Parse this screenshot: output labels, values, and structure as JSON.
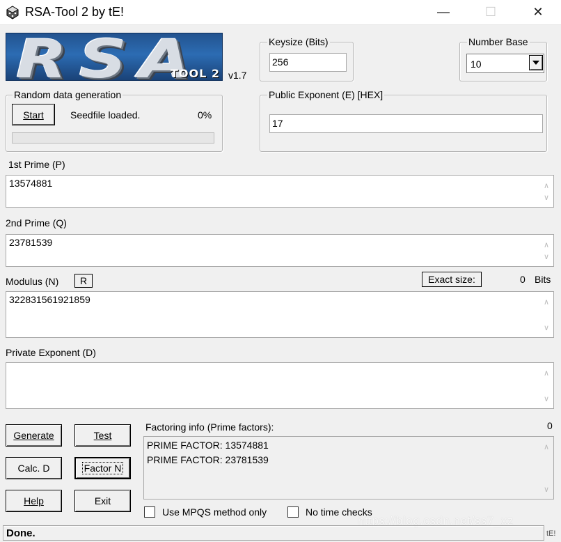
{
  "window": {
    "title": "RSA-Tool 2 by tE!",
    "minimize_glyph": "—",
    "maximize_glyph": "☐",
    "close_glyph": "✕"
  },
  "logo": {
    "main_text": "RSA",
    "sub_text": "TOOL 2",
    "version": "v1.7"
  },
  "keysize": {
    "legend": "Keysize (Bits)",
    "value": "256"
  },
  "number_base": {
    "legend": "Number Base",
    "selected": "10"
  },
  "random_data": {
    "legend": "Random data generation",
    "start_label": "Start",
    "status": "Seedfile loaded.",
    "percent": "0%",
    "progress": 0
  },
  "public_exponent": {
    "legend": "Public Exponent (E) [HEX]",
    "value": "17"
  },
  "prime_p": {
    "label": "1st Prime (P)",
    "value": "13574881"
  },
  "prime_q": {
    "label": "2nd Prime (Q)",
    "value": "23781539"
  },
  "modulus": {
    "label": "Modulus (N)",
    "r_button": "R",
    "exact_size_button": "Exact size:",
    "size_value": "0",
    "bits_label": "Bits",
    "value": "322831561921859"
  },
  "private_exponent": {
    "label": "Private Exponent (D)",
    "value": ""
  },
  "buttons": {
    "generate": "Generate",
    "test": "Test",
    "calc_d": "Calc. D",
    "factor_n": "Factor N",
    "help": "Help",
    "exit": "Exit"
  },
  "factoring": {
    "label": "Factoring info (Prime factors):",
    "count": "0",
    "lines": [
      "PRIME FACTOR: 13574881",
      "PRIME FACTOR: 23781539"
    ],
    "mpqs_label": "Use MPQS method only",
    "no_time_label": "No time checks"
  },
  "status": {
    "text": "Done.",
    "right": "tE!"
  },
  "watermark": "https://blog.csdn.net/ss7_xz",
  "icons": {
    "app": "rsa-tool-app-icon",
    "dropdown": "chevron-down-icon",
    "scroll_up": "scroll-up-icon",
    "scroll_down": "scroll-down-icon"
  }
}
